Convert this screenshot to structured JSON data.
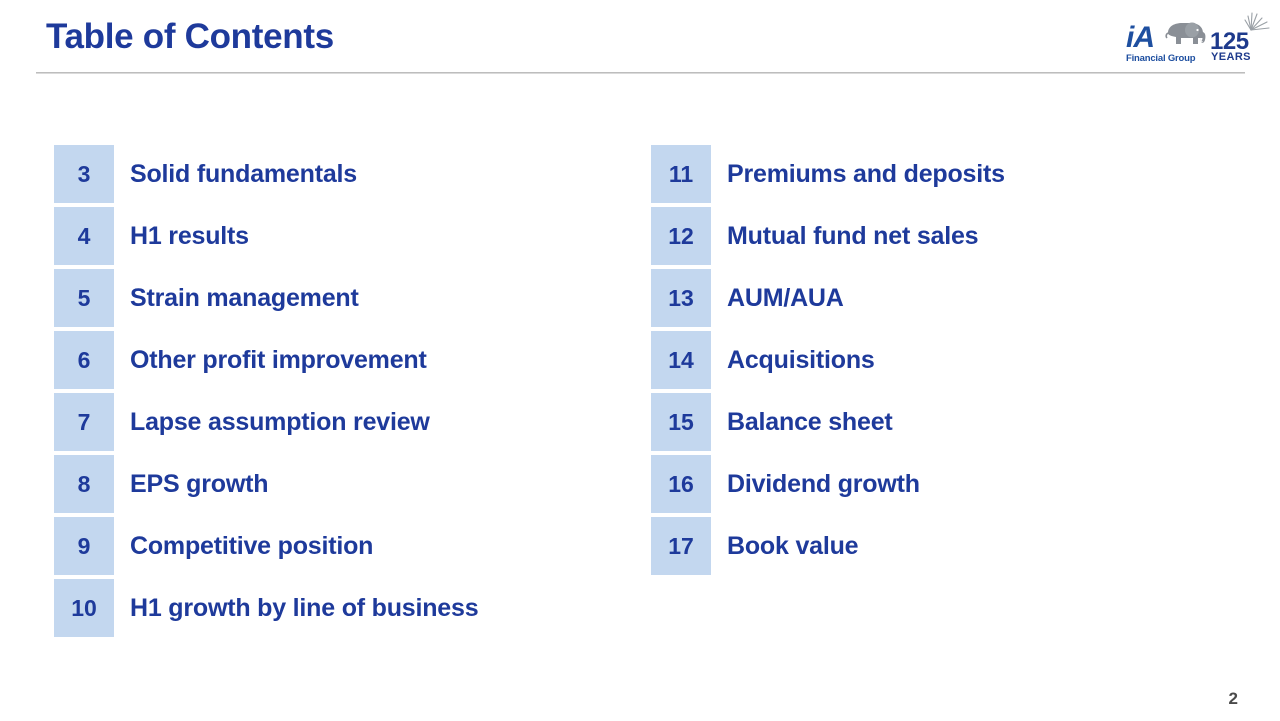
{
  "header": {
    "title": "Table of Contents"
  },
  "logo": {
    "mark": "iA",
    "tagline": "Financial Group",
    "anniversary_number": "125",
    "anniversary_label": "YEARS",
    "elephant_icon_name": "elephant-icon",
    "sparkle_icon_name": "sparkle-icon",
    "colors": {
      "brand_blue": "#1e4fa0",
      "elephant_gray": "#8a8f96",
      "anniversary_blue": "#1e3a8c"
    }
  },
  "toc": {
    "left_column": [
      {
        "page": "3",
        "label": "Solid fundamentals"
      },
      {
        "page": "4",
        "label": "H1 results"
      },
      {
        "page": "5",
        "label": "Strain management"
      },
      {
        "page": "6",
        "label": "Other profit improvement"
      },
      {
        "page": "7",
        "label": "Lapse assumption review"
      },
      {
        "page": "8",
        "label": "EPS growth"
      },
      {
        "page": "9",
        "label": "Competitive position"
      },
      {
        "page": "10",
        "label": "H1 growth by line of business"
      }
    ],
    "right_column": [
      {
        "page": "11",
        "label": "Premiums and deposits"
      },
      {
        "page": "12",
        "label": "Mutual fund net sales"
      },
      {
        "page": "13",
        "label": "AUM/AUA"
      },
      {
        "page": "14",
        "label": "Acquisitions"
      },
      {
        "page": "15",
        "label": "Balance sheet"
      },
      {
        "page": "16",
        "label": "Dividend growth"
      },
      {
        "page": "17",
        "label": "Book value"
      }
    ]
  },
  "footer": {
    "page_number": "2"
  },
  "colors": {
    "title_blue": "#1e3a9b",
    "number_box_fill": "#c3d7ef",
    "divider_gray": "#b0b0b0",
    "page_number_gray": "#4a4a4a",
    "background": "#ffffff"
  }
}
